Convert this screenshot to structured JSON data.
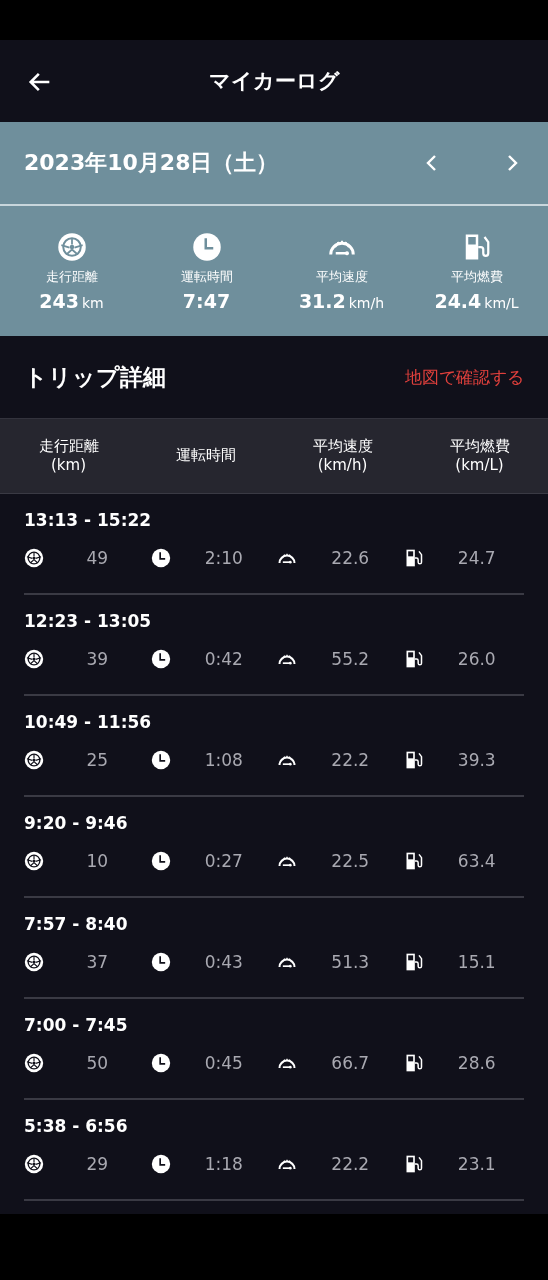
{
  "app_bar": {
    "title": "マイカーログ"
  },
  "date_bar": {
    "date": "2023年10月28日（土）"
  },
  "summary": [
    {
      "kind": "distance",
      "label": "走行距離",
      "value": "243",
      "unit": "km"
    },
    {
      "kind": "time",
      "label": "運転時間",
      "value": "7:47"
    },
    {
      "kind": "speed",
      "label": "平均速度",
      "value": "31.2",
      "unit": "km/h"
    },
    {
      "kind": "fuel",
      "label": "平均燃費",
      "value": "24.4",
      "unit": "km/L"
    }
  ],
  "section": {
    "title": "トリップ詳細",
    "link": "地図で確認する"
  },
  "table": {
    "columns": [
      [
        "走行距離",
        "(km)"
      ],
      [
        "運転時間"
      ],
      [
        "平均速度",
        "(km/h)"
      ],
      [
        "平均燃費",
        "(km/L)"
      ]
    ],
    "rows": [
      {
        "period": "13:13 - 15:22",
        "distance": "49",
        "time": "2:10",
        "speed": "22.6",
        "fuel": "24.7"
      },
      {
        "period": "12:23 - 13:05",
        "distance": "39",
        "time": "0:42",
        "speed": "55.2",
        "fuel": "26.0"
      },
      {
        "period": "10:49 - 11:56",
        "distance": "25",
        "time": "1:08",
        "speed": "22.2",
        "fuel": "39.3"
      },
      {
        "period": "9:20 - 9:46",
        "distance": "10",
        "time": "0:27",
        "speed": "22.5",
        "fuel": "63.4"
      },
      {
        "period": "7:57 - 8:40",
        "distance": "37",
        "time": "0:43",
        "speed": "51.3",
        "fuel": "15.1"
      },
      {
        "period": "7:00 - 7:45",
        "distance": "50",
        "time": "0:45",
        "speed": "66.7",
        "fuel": "28.6"
      },
      {
        "period": "5:38 - 6:56",
        "distance": "29",
        "time": "1:18",
        "speed": "22.2",
        "fuel": "23.1"
      }
    ]
  }
}
